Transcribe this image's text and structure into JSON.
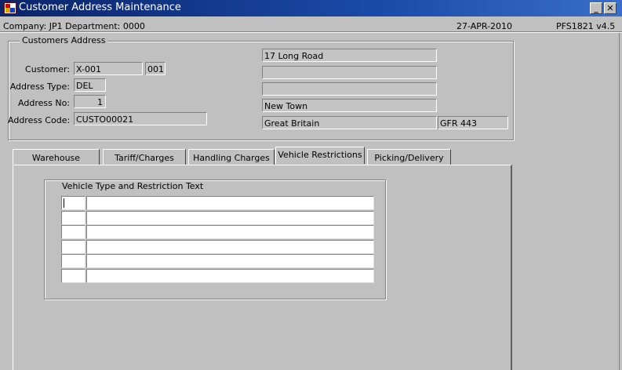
{
  "window": {
    "title": "Customer Address Maintenance",
    "minimize_label": "_",
    "close_label": "✕"
  },
  "info": {
    "company": "Company:  JP1   Department:  0000",
    "date": "27-APR-2010",
    "version": "PFS1821  v4.5"
  },
  "address_group": {
    "title": "Customers Address",
    "customer_label": "Customer:",
    "customer_code": "X-001",
    "customer_suffix": "001",
    "address_type_label": "Address Type:",
    "address_type": "DEL",
    "address_no_label": "Address No:",
    "address_no": "1",
    "address_code_label": "Address Code:",
    "address_code": "CUSTO00021",
    "lines": [
      "17 Long Road",
      "",
      "",
      "New Town"
    ],
    "country": "Great Britain",
    "postcode": "GFR 443"
  },
  "tabs": [
    {
      "label": "Warehouse"
    },
    {
      "label": "Tariff/Charges"
    },
    {
      "label": "Handling Charges"
    },
    {
      "label": "Vehicle  Restrictions"
    },
    {
      "label": "Picking/Delivery"
    }
  ],
  "active_tab": "Vehicle  Restrictions",
  "vehicle_group": {
    "title": "Vehicle Type and Restriction Text",
    "rows": [
      {
        "type": "",
        "text": ""
      },
      {
        "type": "",
        "text": ""
      },
      {
        "type": "",
        "text": ""
      },
      {
        "type": "",
        "text": ""
      },
      {
        "type": "",
        "text": ""
      },
      {
        "type": "",
        "text": ""
      }
    ]
  }
}
